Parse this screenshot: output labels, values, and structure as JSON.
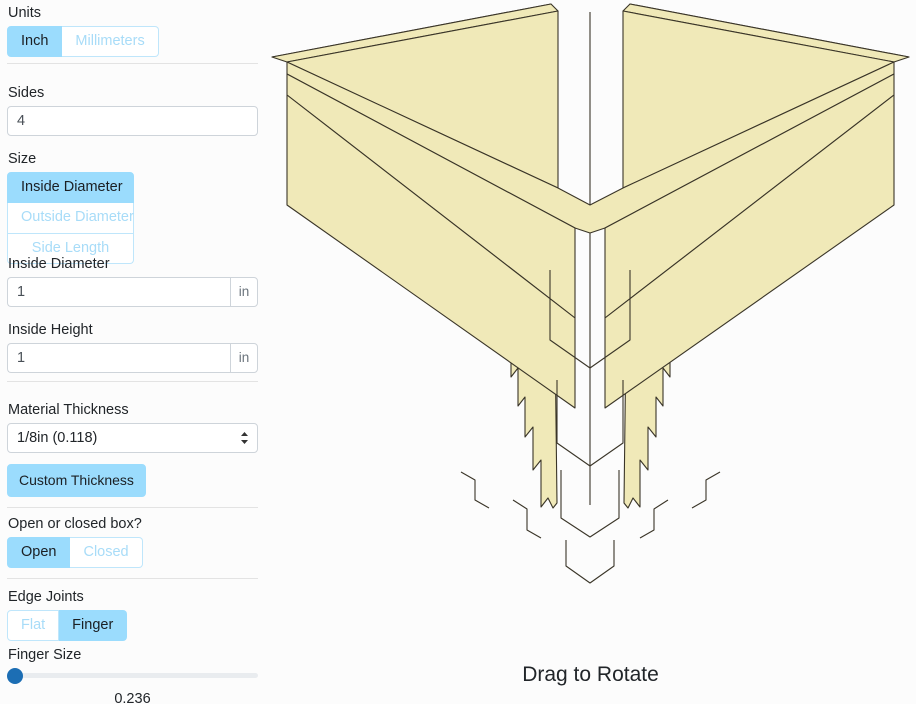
{
  "sidebar": {
    "units": {
      "label": "Units",
      "options": [
        "Inch",
        "Millimeters"
      ],
      "selected": "Inch"
    },
    "sides": {
      "label": "Sides",
      "value": "4",
      "placeholder": ""
    },
    "size": {
      "label": "Size",
      "options": [
        "Inside Diameter",
        "Outside Diameter",
        "Side Length"
      ],
      "selected": "Inside Diameter"
    },
    "inside_diameter": {
      "label": "Inside Diameter",
      "value": "1",
      "unit": "in"
    },
    "inside_height": {
      "label": "Inside Height",
      "value": "1",
      "unit": "in"
    },
    "material_thickness": {
      "label": "Material Thickness",
      "selected": "1/8in (0.118)",
      "options": [
        "1/8in (0.118)"
      ],
      "custom_button": "Custom Thickness"
    },
    "open_closed": {
      "label": "Open or closed box?",
      "options": [
        "Open",
        "Closed"
      ],
      "selected": "Open"
    },
    "edge_joints": {
      "label": "Edge Joints",
      "options": [
        "Flat",
        "Finger"
      ],
      "selected": "Finger"
    },
    "finger_size": {
      "label": "Finger Size",
      "value": "0.236",
      "slider_position_pct": 0
    }
  },
  "viewport": {
    "drag_label": "Drag to Rotate"
  },
  "colors": {
    "accent_active": "#9bdcfd",
    "accent_inactive_text": "#a8dcf8",
    "slider_thumb": "#1c6eb4",
    "box_fill": "#f0e9b8",
    "box_stroke": "#3a3528",
    "page_bg": "#fcfcfc"
  }
}
